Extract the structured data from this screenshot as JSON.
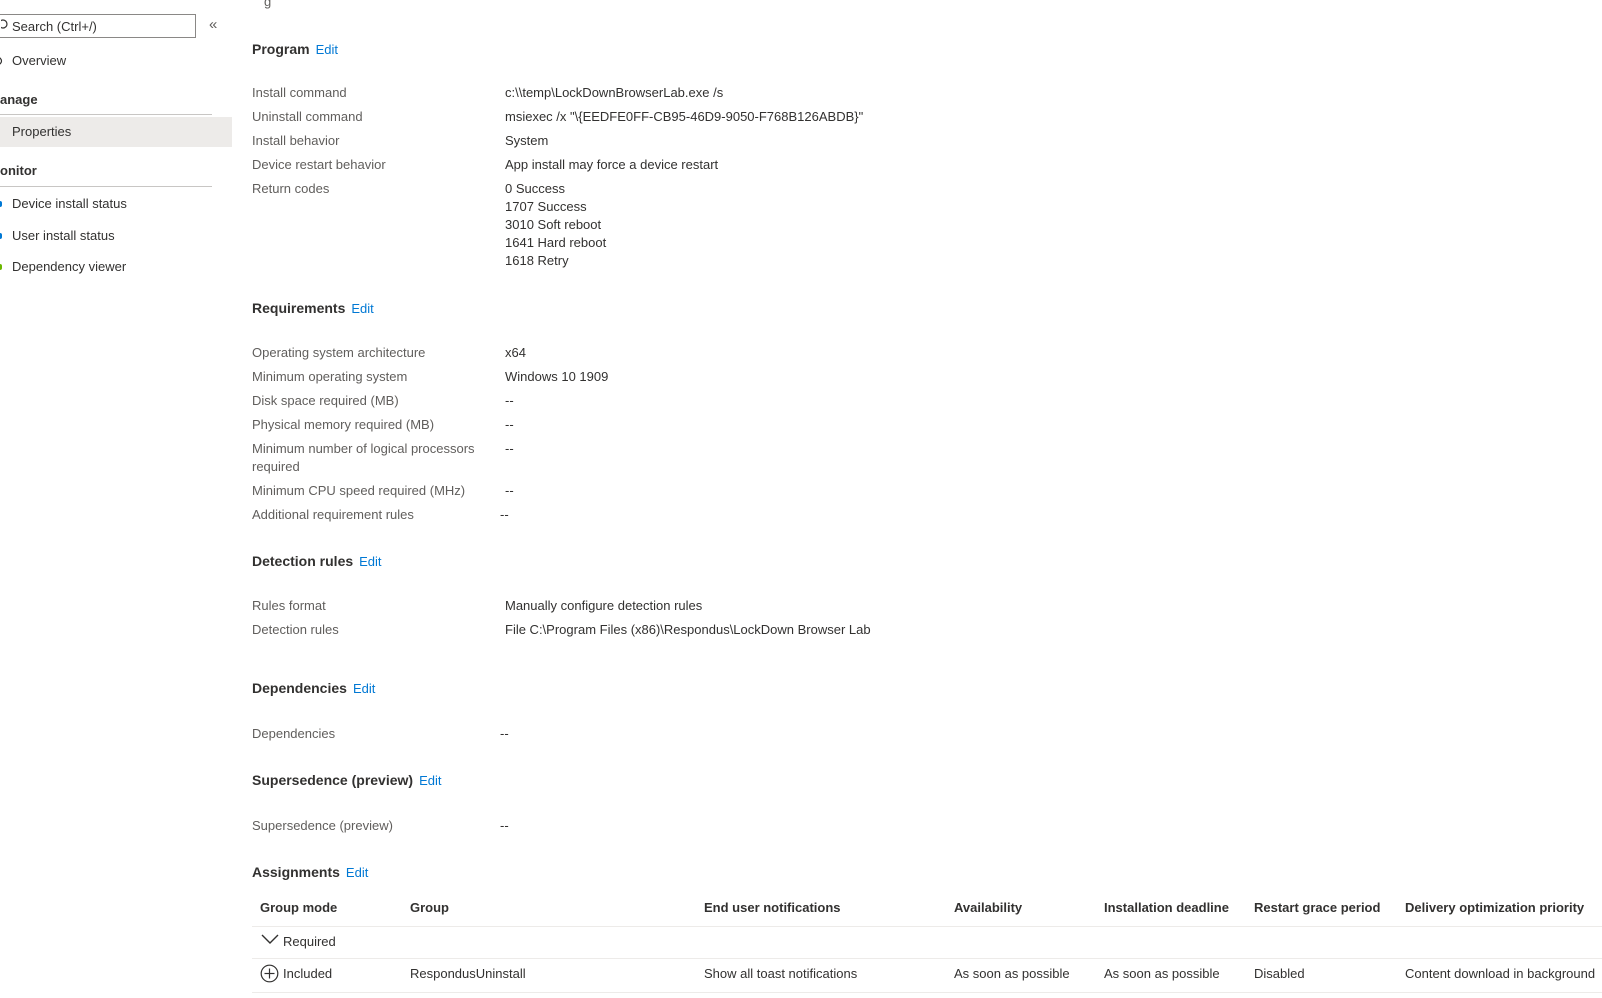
{
  "sidebar": {
    "search_placeholder": "Search (Ctrl+/)",
    "collapse_glyph": "«",
    "overview_label": "Overview",
    "manage_header": "anage",
    "properties_label": "Properties",
    "monitor_header": "onitor",
    "monitor_items": [
      {
        "label": "Device install status",
        "bullet_color": "#0078d4"
      },
      {
        "label": "User install status",
        "bullet_color": "#0078d4"
      },
      {
        "label": "Dependency viewer",
        "bullet_color": "#6bb700"
      }
    ]
  },
  "top_clipped_text": "g",
  "program": {
    "title": "Program",
    "edit": "Edit",
    "rows": [
      {
        "label": "Install command",
        "value": "c:\\\\temp\\LockDownBrowserLab.exe /s"
      },
      {
        "label": "Uninstall command",
        "value": "msiexec /x \"\\{EEDFE0FF-CB95-46D9-9050-F768B126ABDB}\""
      },
      {
        "label": "Install behavior",
        "value": "System"
      },
      {
        "label": "Device restart behavior",
        "value": "App install may force a device restart"
      },
      {
        "label": "Return codes",
        "values": [
          "0 Success",
          "1707 Success",
          "3010 Soft reboot",
          "1641 Hard reboot",
          "1618 Retry"
        ]
      }
    ]
  },
  "requirements": {
    "title": "Requirements",
    "edit": "Edit",
    "rows": [
      {
        "label": "Operating system architecture",
        "value": "x64"
      },
      {
        "label": "Minimum operating system",
        "value": "Windows 10 1909"
      },
      {
        "label": "Disk space required (MB)",
        "value": "--"
      },
      {
        "label": "Physical memory required (MB)",
        "value": "--"
      },
      {
        "label": "Minimum number of logical processors required",
        "value": "--"
      },
      {
        "label": "Minimum CPU speed required (MHz)",
        "value": "--"
      },
      {
        "label": "Additional requirement rules",
        "value": "--"
      }
    ]
  },
  "detection": {
    "title": "Detection rules",
    "edit": "Edit",
    "rows": [
      {
        "label": "Rules format",
        "value": "Manually configure detection rules"
      },
      {
        "label": "Detection rules",
        "value": "File C:\\Program Files (x86)\\Respondus\\LockDown Browser Lab"
      }
    ]
  },
  "dependencies": {
    "title": "Dependencies",
    "edit": "Edit",
    "label": "Dependencies",
    "value": "--"
  },
  "supersedence": {
    "title": "Supersedence (preview)",
    "edit": "Edit",
    "label": "Supersedence (preview)",
    "value": "--"
  },
  "assignments": {
    "title": "Assignments",
    "edit": "Edit",
    "columns": [
      "Group mode",
      "Group",
      "End user notifications",
      "Availability",
      "Installation deadline",
      "Restart grace period",
      "Delivery optimization priority"
    ],
    "group_label": "Required",
    "row": [
      "Included",
      "RespondusUninstall",
      "Show all toast notifications",
      "As soon as possible",
      "As soon as possible",
      "Disabled",
      "Content download in background"
    ]
  }
}
